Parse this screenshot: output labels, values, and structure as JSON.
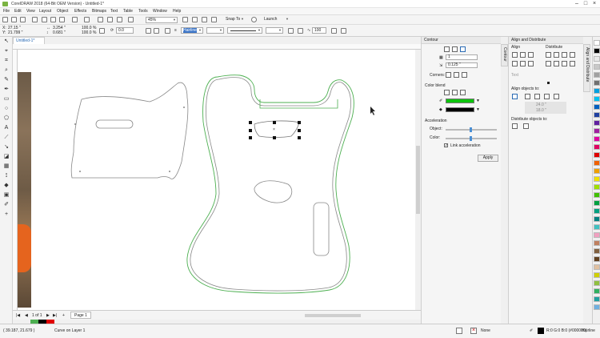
{
  "window": {
    "title": "CorelDRAW 2018 (64-Bit OEM Version) - Untitled-1*"
  },
  "menu": [
    "File",
    "Edit",
    "View",
    "Layout",
    "Object",
    "Effects",
    "Bitmaps",
    "Text",
    "Table",
    "Tools",
    "Window",
    "Help"
  ],
  "toolbar": {
    "zoom": "45%",
    "snap_to": "Snap To",
    "launch": "Launch"
  },
  "propbar": {
    "x": "27.15 \"",
    "y": "21.799 \"",
    "w": "3.254 \"",
    "h": "0.681 \"",
    "scale_w": "100.0",
    "scale_h": "100.0",
    "pct": "%",
    "angle": "0.0",
    "outline": "Hairline",
    "outline_pct": "100"
  },
  "document": {
    "tab": "Untitled-1*",
    "page_counter": "1 of 1",
    "page_tab": "Page 1"
  },
  "contour": {
    "title": "Contour",
    "steps": "1",
    "offset": "0.125 \"",
    "corners_label": "Corners:",
    "color_blend_label": "Color blend",
    "acceleration_label": "Acceleration",
    "object_label": "Object:",
    "color_label": "Color:",
    "link_label": "Link acceleration",
    "apply": "Apply",
    "outline_color": "#0dc40d",
    "fill_color": "#000000"
  },
  "align": {
    "title": "Align and Distribute",
    "align_label": "Align",
    "distribute_label": "Distribute",
    "text_label": "Text",
    "align_to_label": "Align objects to:",
    "val1": "24.0 \"",
    "val2": "18.0 \"",
    "distribute_to_label": "Distribute objects to:"
  },
  "side_tabs": [
    "Contour",
    "Align and Distribute"
  ],
  "status": {
    "coords": "( 39.187, 21.679 )",
    "object_info": "Curve on Layer 1",
    "fill_none": "None",
    "outline_info": "R:0 G:0 B:0 (#000000)",
    "outline_width": "Hairline"
  },
  "palette": [
    "#ffffff",
    "#000000",
    "#e8e8e8",
    "#c8c8c8",
    "#a0a0a0",
    "#707070",
    "#00a0e0",
    "#00c0f0",
    "#0060c0",
    "#2040a0",
    "#6020a0",
    "#a020a0",
    "#e000a0",
    "#e00060",
    "#e00000",
    "#f06000",
    "#f0a000",
    "#f0e000",
    "#a0e000",
    "#40c000",
    "#00a040",
    "#00a080",
    "#008080",
    "#40c0c0",
    "#f0a0c0",
    "#c08060",
    "#806040",
    "#604020",
    "#e0c0a0",
    "#d0d000",
    "#90c040",
    "#30b060",
    "#20a0a0",
    "#70b0e0"
  ]
}
